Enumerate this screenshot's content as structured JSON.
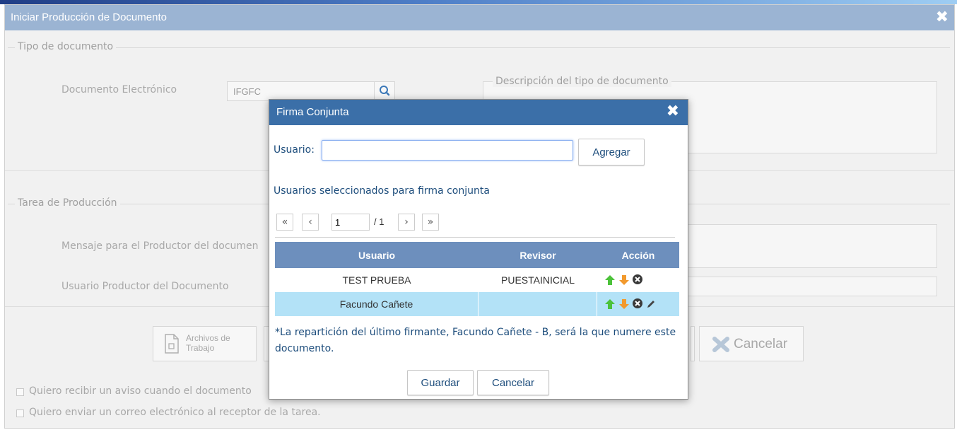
{
  "window": {
    "title": "Iniciar Producción de Documento",
    "close_icon": "close-icon",
    "section_tipo": "Tipo de documento",
    "doc_label": "Documento Electrónico",
    "doc_value": "IFGFC",
    "desc_legend": "Descripción del tipo de documento",
    "section_tarea": "Tarea de Producción",
    "mensaje_label": "Mensaje para el Productor del documen",
    "productor_label": "Usuario Productor del Documento",
    "archivos_line1": "Archivos de",
    "archivos_line2": "Trabajo",
    "cancelar_label": "Cancelar",
    "check1_label": "Quiero recibir un aviso cuando el documento",
    "check2_label": "Quiero enviar un correo electrónico al receptor de la tarea."
  },
  "modal": {
    "title": "Firma Conjunta",
    "usuario_label": "Usuario:",
    "usuario_value": "",
    "agregar_label": "Agregar",
    "selected_heading": "Usuarios seleccionados para firma conjunta",
    "pagination": {
      "first": "«",
      "prev": "‹",
      "page": "1",
      "total": "/ 1",
      "next": "›",
      "last": "»"
    },
    "table": {
      "headers": [
        "Usuario",
        "Revisor",
        "Acción"
      ],
      "rows": [
        {
          "usuario": "TEST PRUEBA",
          "revisor": "PUESTAINICIAL"
        },
        {
          "usuario": "Facundo Cañete",
          "revisor": ""
        }
      ]
    },
    "note": "*La repartición del último firmante, Facundo Cañete - B, será la que numere este documento.",
    "guardar_label": "Guardar",
    "cancelar_label": "Cancelar"
  },
  "colors": {
    "header_bg": "#9bb4d3",
    "modal_header": "#3b6fa8",
    "table_header": "#6d8fbd",
    "selected_row": "#b3e2f7",
    "text_blue": "#1d4d7c"
  }
}
